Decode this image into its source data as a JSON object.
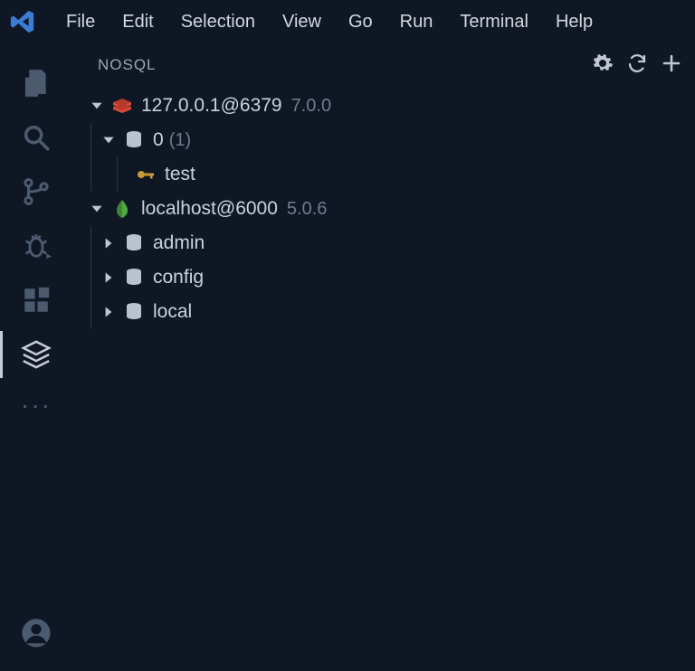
{
  "menubar": {
    "items": [
      "File",
      "Edit",
      "Selection",
      "View",
      "Go",
      "Run",
      "Terminal",
      "Help"
    ]
  },
  "sidebar": {
    "title": "NOSQL"
  },
  "connections": [
    {
      "kind": "redis",
      "label": "127.0.0.1@6379",
      "version": "7.0.0",
      "expanded": true,
      "children": [
        {
          "kind": "db",
          "label": "0",
          "count_label": "(1)",
          "expanded": true,
          "children": [
            {
              "kind": "key",
              "label": "test"
            }
          ]
        }
      ]
    },
    {
      "kind": "mongo",
      "label": "localhost@6000",
      "version": "5.0.6",
      "expanded": true,
      "children": [
        {
          "kind": "db",
          "label": "admin",
          "expanded": false
        },
        {
          "kind": "db",
          "label": "config",
          "expanded": false
        },
        {
          "kind": "db",
          "label": "local",
          "expanded": false
        }
      ]
    }
  ]
}
